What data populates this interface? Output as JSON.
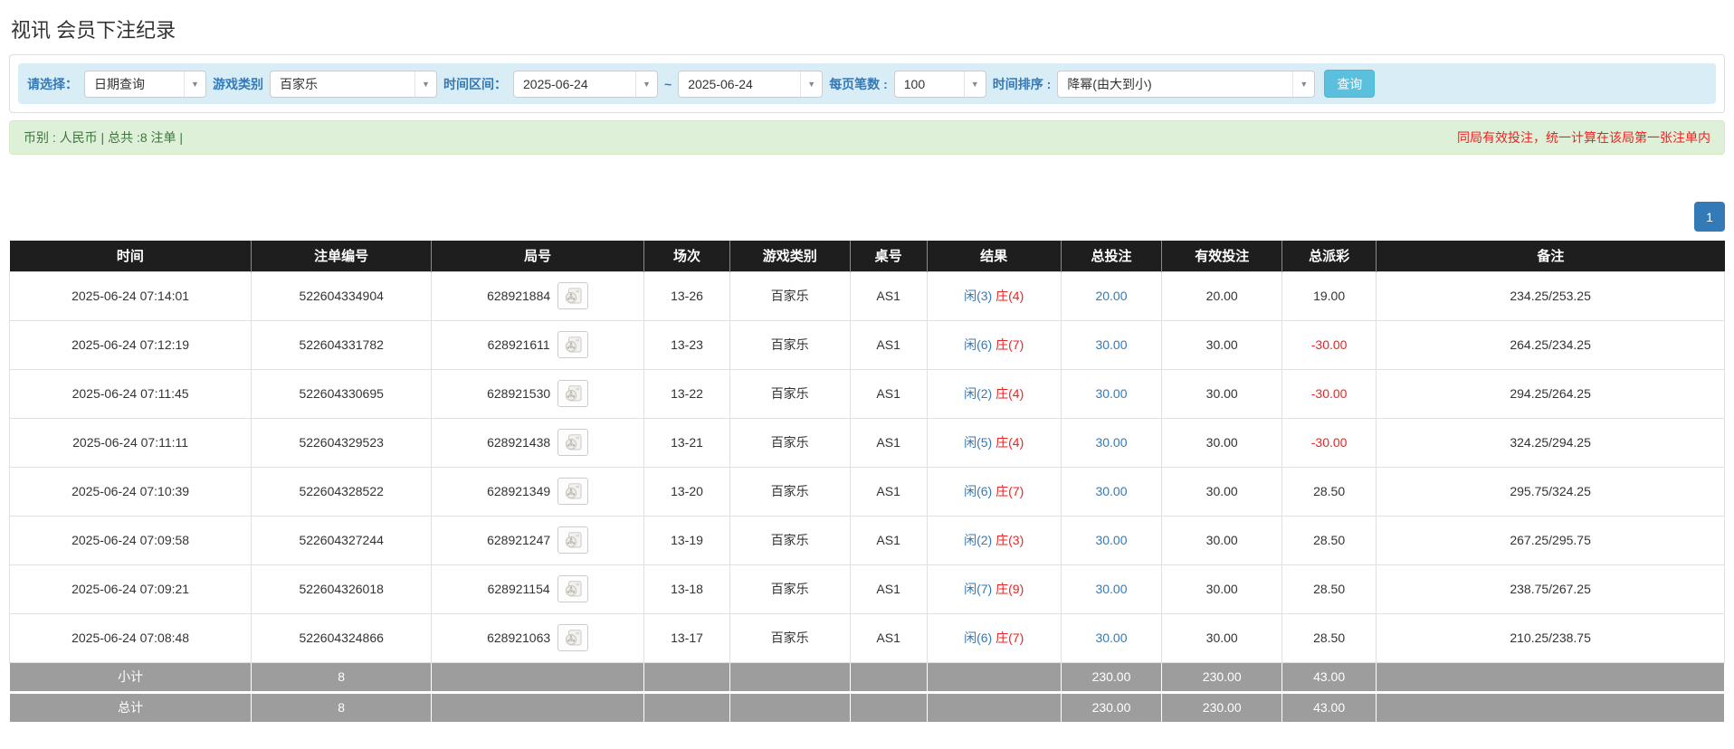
{
  "page": {
    "title": "视讯 会员下注纪录"
  },
  "filters": {
    "select_label": "请选择：",
    "query_type": "日期查询",
    "game_category_label": "游戏类别",
    "game_category": "百家乐",
    "time_range_label": "时间区间：",
    "date_from": "2025-06-24",
    "tilde": "~",
    "date_to": "2025-06-24",
    "page_size_label": "每页笔数 :",
    "page_size": "100",
    "sort_label": "时间排序 :",
    "sort_order": "降幂(由大到小)",
    "search_button": "查询"
  },
  "summary": {
    "left": "币别 : 人民币 | 总共 :8 注单 |",
    "note": "同局有效投注，统一计算在该局第一张注单内"
  },
  "pagination": {
    "current": "1"
  },
  "table": {
    "headers": [
      "时间",
      "注单编号",
      "局号",
      "场次",
      "游戏类别",
      "桌号",
      "结果",
      "总投注",
      "有效投注",
      "总派彩",
      "备注"
    ],
    "rows": [
      {
        "time": "2025-06-24 07:14:01",
        "bet_id": "522604334904",
        "round": "628921884",
        "session": "13-26",
        "game": "百家乐",
        "table_no": "AS1",
        "result_player": "闲(3)",
        "result_banker": "庄(4)",
        "total_bet": "20.00",
        "valid_bet": "20.00",
        "payout": "19.00",
        "note": "234.25/253.25"
      },
      {
        "time": "2025-06-24 07:12:19",
        "bet_id": "522604331782",
        "round": "628921611",
        "session": "13-23",
        "game": "百家乐",
        "table_no": "AS1",
        "result_player": "闲(6)",
        "result_banker": "庄(7)",
        "total_bet": "30.00",
        "valid_bet": "30.00",
        "payout": "-30.00",
        "note": "264.25/234.25"
      },
      {
        "time": "2025-06-24 07:11:45",
        "bet_id": "522604330695",
        "round": "628921530",
        "session": "13-22",
        "game": "百家乐",
        "table_no": "AS1",
        "result_player": "闲(2)",
        "result_banker": "庄(4)",
        "total_bet": "30.00",
        "valid_bet": "30.00",
        "payout": "-30.00",
        "note": "294.25/264.25"
      },
      {
        "time": "2025-06-24 07:11:11",
        "bet_id": "522604329523",
        "round": "628921438",
        "session": "13-21",
        "game": "百家乐",
        "table_no": "AS1",
        "result_player": "闲(5)",
        "result_banker": "庄(4)",
        "total_bet": "30.00",
        "valid_bet": "30.00",
        "payout": "-30.00",
        "note": "324.25/294.25"
      },
      {
        "time": "2025-06-24 07:10:39",
        "bet_id": "522604328522",
        "round": "628921349",
        "session": "13-20",
        "game": "百家乐",
        "table_no": "AS1",
        "result_player": "闲(6)",
        "result_banker": "庄(7)",
        "total_bet": "30.00",
        "valid_bet": "30.00",
        "payout": "28.50",
        "note": "295.75/324.25"
      },
      {
        "time": "2025-06-24 07:09:58",
        "bet_id": "522604327244",
        "round": "628921247",
        "session": "13-19",
        "game": "百家乐",
        "table_no": "AS1",
        "result_player": "闲(2)",
        "result_banker": "庄(3)",
        "total_bet": "30.00",
        "valid_bet": "30.00",
        "payout": "28.50",
        "note": "267.25/295.75"
      },
      {
        "time": "2025-06-24 07:09:21",
        "bet_id": "522604326018",
        "round": "628921154",
        "session": "13-18",
        "game": "百家乐",
        "table_no": "AS1",
        "result_player": "闲(7)",
        "result_banker": "庄(9)",
        "total_bet": "30.00",
        "valid_bet": "30.00",
        "payout": "28.50",
        "note": "238.75/267.25"
      },
      {
        "time": "2025-06-24 07:08:48",
        "bet_id": "522604324866",
        "round": "628921063",
        "session": "13-17",
        "game": "百家乐",
        "table_no": "AS1",
        "result_player": "闲(6)",
        "result_banker": "庄(7)",
        "total_bet": "30.00",
        "valid_bet": "30.00",
        "payout": "28.50",
        "note": "210.25/238.75"
      }
    ],
    "subtotal": {
      "label": "小计",
      "count": "8",
      "total_bet": "230.00",
      "valid_bet": "230.00",
      "payout": "43.00"
    },
    "total": {
      "label": "总计",
      "count": "8",
      "total_bet": "230.00",
      "valid_bet": "230.00",
      "payout": "43.00"
    }
  },
  "colors": {
    "accent_blue": "#337ab7",
    "negative_red": "#ee2222",
    "filter_bar_bg": "#d9edf7",
    "alert_bg": "#dff0d8",
    "alert_text": "#3c763d",
    "search_button_bg": "#5bc0de",
    "table_header_bg": "#1e1e1e",
    "table_footer_bg": "#9d9d9d"
  }
}
